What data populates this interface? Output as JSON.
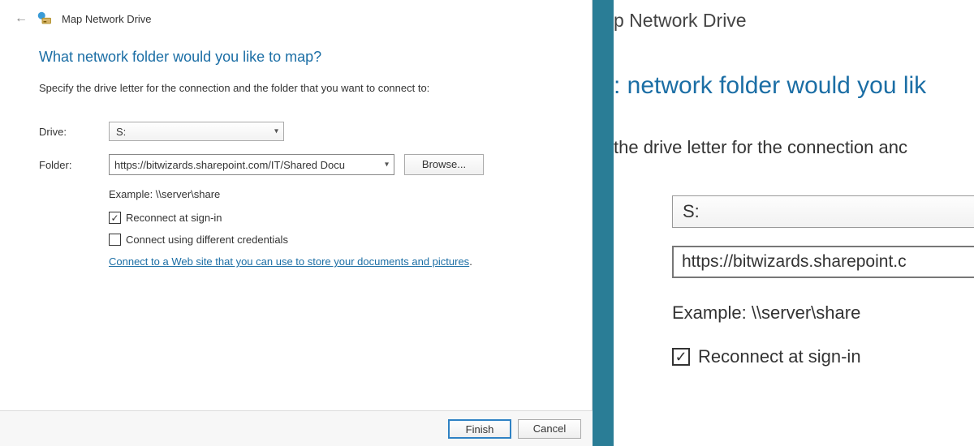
{
  "dialog": {
    "wizard_title": "Map Network Drive",
    "headline": "What network folder would you like to map?",
    "instruction": "Specify the drive letter for the connection and the folder that you want to connect to:",
    "drive_label": "Drive:",
    "drive_value": "S:",
    "folder_label": "Folder:",
    "folder_value": "https://bitwizards.sharepoint.com/IT/Shared Docu",
    "browse_label": "Browse...",
    "example_text": "Example: \\\\server\\share",
    "reconnect_label": "Reconnect at sign-in",
    "reconnect_checked": true,
    "diffcreds_label": "Connect using different credentials",
    "diffcreds_checked": false,
    "link_text": "Connect to a Web site that you can use to store your documents and pictures",
    "finish_label": "Finish",
    "cancel_label": "Cancel"
  },
  "zoom": {
    "title_fragment": "p Network Drive",
    "headline_fragment": ": network folder would you lik",
    "instruction_fragment": "  the drive letter for the connection anc",
    "drive_value": "S:",
    "folder_fragment": "https://bitwizards.sharepoint.c",
    "example_text": "Example: \\\\server\\share",
    "reconnect_label": "Reconnect at sign-in"
  }
}
